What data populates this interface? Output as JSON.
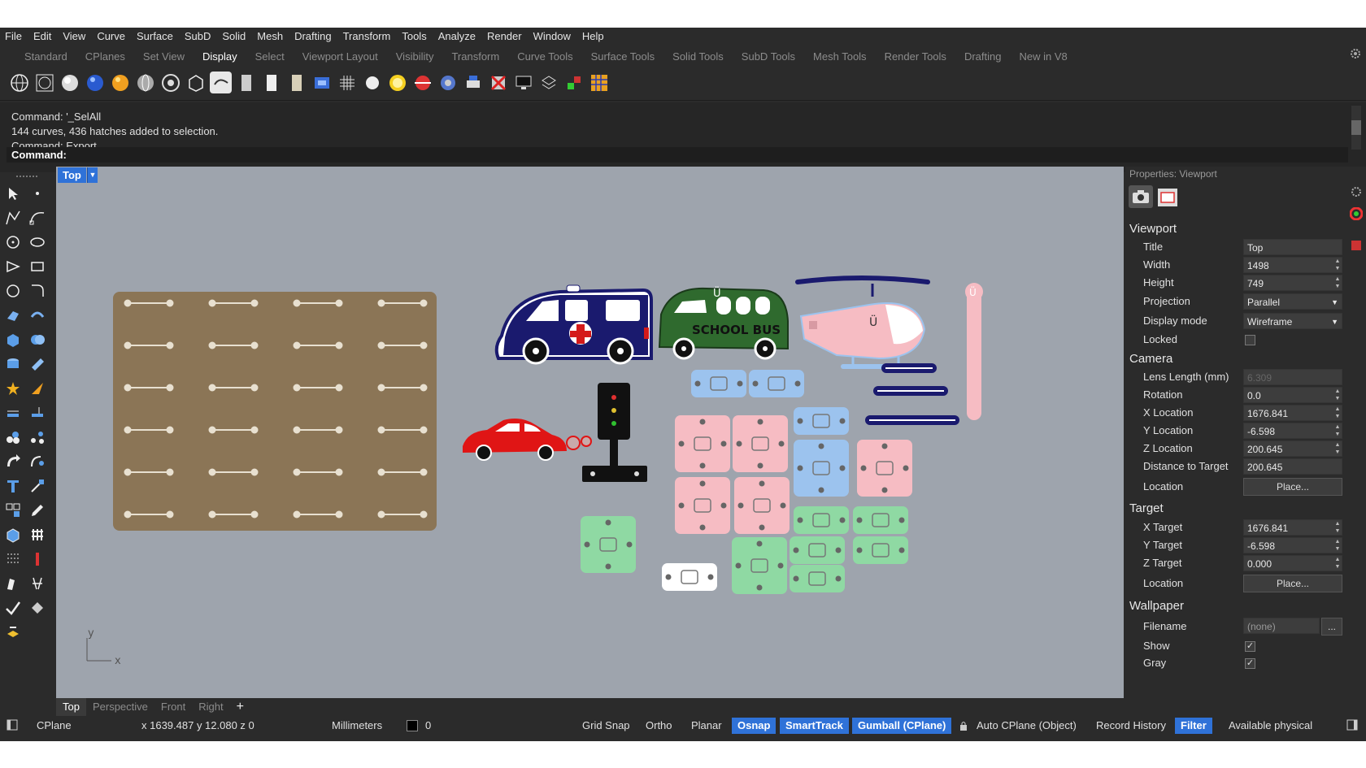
{
  "menu": [
    "File",
    "Edit",
    "View",
    "Curve",
    "Surface",
    "SubD",
    "Solid",
    "Mesh",
    "Drafting",
    "Transform",
    "Tools",
    "Analyze",
    "Render",
    "Window",
    "Help"
  ],
  "tabs": [
    "Standard",
    "CPlanes",
    "Set View",
    "Display",
    "Select",
    "Viewport Layout",
    "Visibility",
    "Transform",
    "Curve Tools",
    "Surface Tools",
    "Solid Tools",
    "SubD Tools",
    "Mesh Tools",
    "Render Tools",
    "Drafting",
    "New in V8"
  ],
  "active_tab": "Display",
  "command_history": [
    "Command: '_SelAll",
    "144 curves, 436 hatches added to selection.",
    "Command: Export"
  ],
  "command_prompt": "Command:",
  "viewport": {
    "title": "Top",
    "axis_y": "y",
    "axis_x": "x",
    "bus_text": "SCHOOL BUS",
    "magnet_glyph": "Ü"
  },
  "viewport_tabs": [
    "Top",
    "Perspective",
    "Front",
    "Right"
  ],
  "add_tab": "+",
  "properties": {
    "header": "Properties: Viewport",
    "viewport_section": "Viewport",
    "title_label": "Title",
    "title_value": "Top",
    "width_label": "Width",
    "width_value": "1498",
    "height_label": "Height",
    "height_value": "749",
    "projection_label": "Projection",
    "projection_value": "Parallel",
    "display_mode_label": "Display mode",
    "display_mode_value": "Wireframe",
    "locked_label": "Locked",
    "camera_section": "Camera",
    "lens_label": "Lens Length (mm)",
    "lens_value": "6.309",
    "rotation_label": "Rotation",
    "rotation_value": "0.0",
    "xloc_label": "X Location",
    "xloc_value": "1676.841",
    "yloc_label": "Y Location",
    "yloc_value": "-6.598",
    "zloc_label": "Z Location",
    "zloc_value": "200.645",
    "dist_label": "Distance to Target",
    "dist_value": "200.645",
    "location_label": "Location",
    "place_button": "Place...",
    "target_section": "Target",
    "xtarget_label": "X Target",
    "xtarget_value": "1676.841",
    "ytarget_label": "Y Target",
    "ytarget_value": "-6.598",
    "ztarget_label": "Z Target",
    "ztarget_value": "0.000",
    "tlocation_label": "Location",
    "tplace_button": "Place...",
    "wallpaper_section": "Wallpaper",
    "filename_label": "Filename",
    "filename_value": "(none)",
    "browse_button": "...",
    "show_label": "Show",
    "gray_label": "Gray",
    "check_mark": "✓"
  },
  "status": {
    "cplane": "CPlane",
    "coords": "x 1639.487  y 12.080  z 0",
    "units": "Millimeters",
    "layer_value": "0",
    "grid_snap": "Grid Snap",
    "ortho": "Ortho",
    "planar": "Planar",
    "osnap": "Osnap",
    "smarttrack": "SmartTrack",
    "gumball": "Gumball (CPlane)",
    "auto_cplane": "Auto CPlane (Object)",
    "record_history": "Record History",
    "filter": "Filter",
    "available": "Available physical"
  },
  "colors": {
    "board": "#8b7556",
    "pink": "#f6bcc3",
    "blue": "#9cc3ee",
    "green": "#8fd9a3",
    "navy": "#1a1a6e",
    "bus_green": "#2f6a2e",
    "car_red": "#e01515",
    "accent": "#2f72d8"
  }
}
